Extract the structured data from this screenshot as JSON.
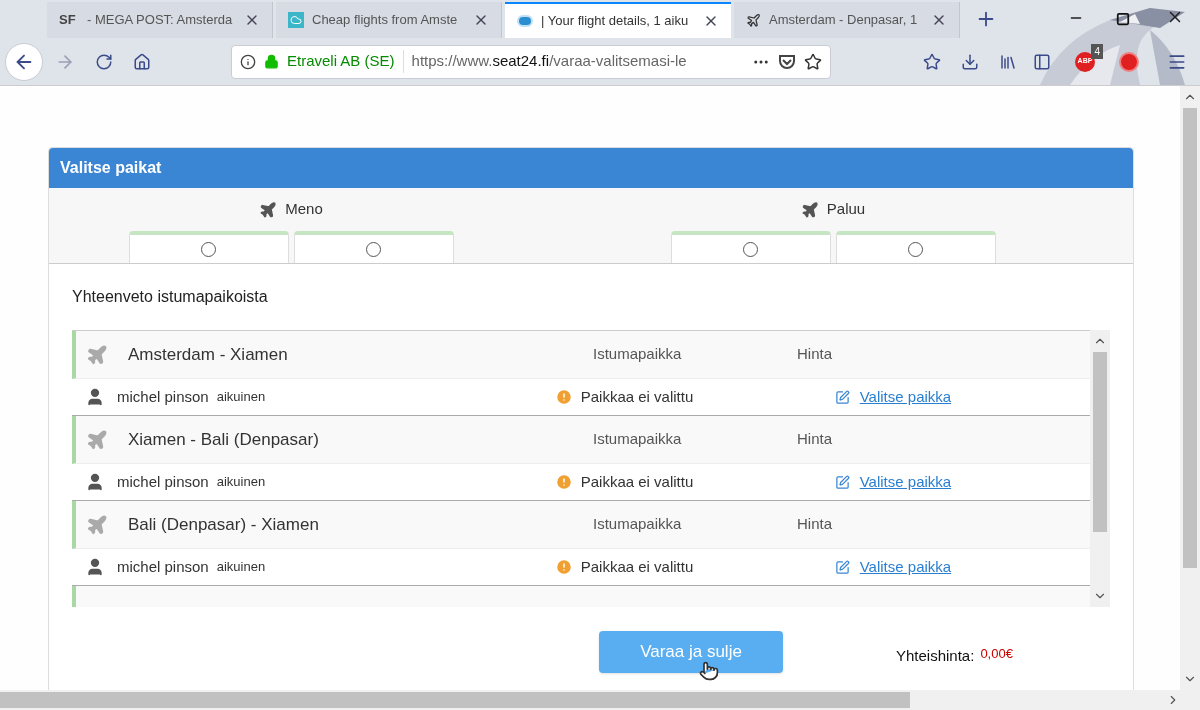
{
  "browser": {
    "tabs": [
      {
        "kind": "sf",
        "favicon_text": "SF",
        "title": "- MEGA POST: Amsterda",
        "selected": false
      },
      {
        "kind": "cloud",
        "title": "Cheap flights from Amste",
        "selected": false
      },
      {
        "kind": "dot",
        "title": "| Your flight details, 1 aiku",
        "selected": true
      },
      {
        "kind": "plane",
        "title": "Amsterdam - Denpasar, 1",
        "selected": false
      }
    ],
    "identity": "Etraveli AB (SE)",
    "url_prefix": "https://www.",
    "url_domain": "seat24.fi",
    "url_path": "/varaa-valitsemasi-le",
    "adblock_label": "ABP",
    "adblock_count": "4"
  },
  "modal": {
    "title": "Valitse paikat",
    "directions": [
      {
        "label": "Meno",
        "flights": [
          {
            "checked": false
          },
          {
            "checked": false
          }
        ]
      },
      {
        "label": "Paluu",
        "flights": [
          {
            "checked": false
          },
          {
            "checked": false
          }
        ]
      }
    ],
    "summary_title": "Yhteenveto istumapaikoista",
    "segments": [
      {
        "route": "Amsterdam - Xiamen",
        "seat_header": "Istumapaikka",
        "price_header": "Hinta",
        "passengers": [
          {
            "name": "michel pinson",
            "type": "aikuinen",
            "status": "Paikkaa ei valittu",
            "action": "Valitse paikka"
          }
        ]
      },
      {
        "route": "Xiamen - Bali (Denpasar)",
        "seat_header": "Istumapaikka",
        "price_header": "Hinta",
        "passengers": [
          {
            "name": "michel pinson",
            "type": "aikuinen",
            "status": "Paikkaa ei valittu",
            "action": "Valitse paikka"
          }
        ]
      },
      {
        "route": "Bali (Denpasar) - Xiamen",
        "seat_header": "Istumapaikka",
        "price_header": "Hinta",
        "passengers": [
          {
            "name": "michel pinson",
            "type": "aikuinen",
            "status": "Paikkaa ei valittu",
            "action": "Valitse paikka"
          }
        ]
      }
    ],
    "submit": "Varaa ja sulje",
    "total_label": "Yhteishinta:",
    "total_value": "0,00€"
  }
}
